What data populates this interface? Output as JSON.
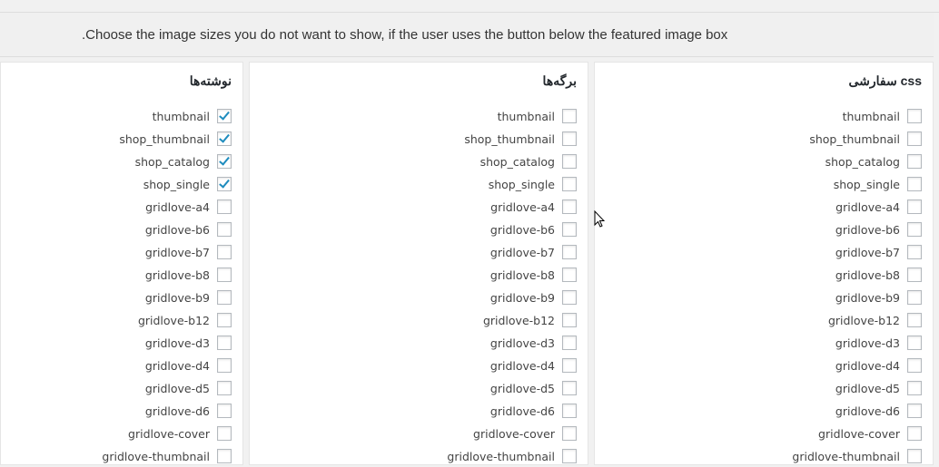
{
  "notice": ".Choose the image sizes you do not want to show, if the user uses the button below the featured image box",
  "sizes": [
    "thumbnail",
    "shop_thumbnail",
    "shop_catalog",
    "shop_single",
    "gridlove-a4",
    "gridlove-b6",
    "gridlove-b7",
    "gridlove-b8",
    "gridlove-b9",
    "gridlove-b12",
    "gridlove-d3",
    "gridlove-d4",
    "gridlove-d5",
    "gridlove-d6",
    "gridlove-cover",
    "gridlove-thumbnail"
  ],
  "panels": [
    {
      "title": "css سفارشی",
      "checked": []
    },
    {
      "title": "برگه‌ها",
      "checked": []
    },
    {
      "title": "نوشته‌ها",
      "checked": [
        "thumbnail",
        "shop_thumbnail",
        "shop_catalog",
        "shop_single"
      ]
    }
  ],
  "accent": "#1e8cbe"
}
